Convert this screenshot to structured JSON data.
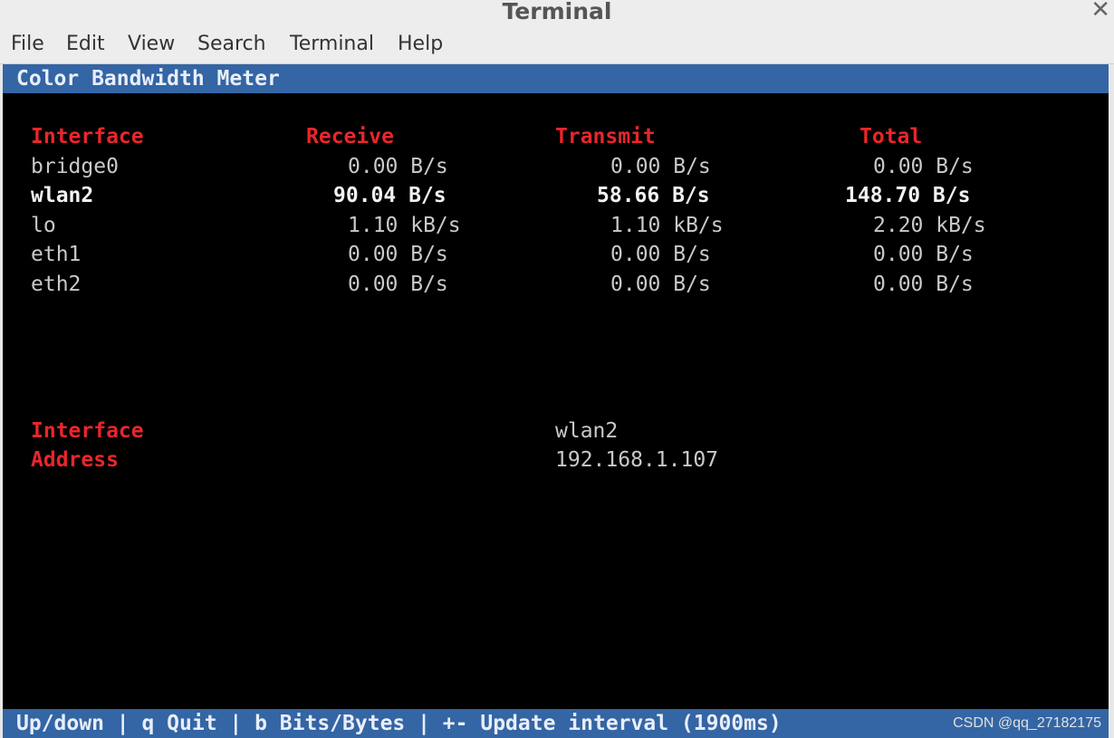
{
  "window": {
    "title": "Terminal"
  },
  "menu": [
    "File",
    "Edit",
    "View",
    "Search",
    "Terminal",
    "Help"
  ],
  "app": {
    "header": "Color Bandwidth Meter",
    "table": {
      "columns": [
        "Interface",
        "Receive",
        "Transmit",
        "Total"
      ],
      "rows": [
        {
          "iface": "bridge0",
          "receive": "0.00 B/s",
          "transmit": "0.00 B/s",
          "total": "0.00 B/s",
          "active": false
        },
        {
          "iface": "wlan2",
          "receive": "90.04 B/s",
          "transmit": "58.66 B/s",
          "total": "148.70 B/s",
          "active": true
        },
        {
          "iface": "lo",
          "receive": "1.10 kB/s",
          "transmit": "1.10 kB/s",
          "total": "2.20 kB/s",
          "active": false
        },
        {
          "iface": "eth1",
          "receive": "0.00 B/s",
          "transmit": "0.00 B/s",
          "total": "0.00 B/s",
          "active": false
        },
        {
          "iface": "eth2",
          "receive": "0.00 B/s",
          "transmit": "0.00 B/s",
          "total": "0.00 B/s",
          "active": false
        }
      ]
    },
    "details": {
      "interface_label": "Interface",
      "interface_value": "wlan2",
      "address_label": "Address",
      "address_value": "192.168.1.107"
    },
    "footer": "Up/down | q Quit | b Bits/Bytes | +- Update interval (1900ms)"
  },
  "watermark": "CSDN @qq_27182175",
  "colors": {
    "header_red": "#e8262b",
    "bar_blue": "#3465a4",
    "terminal_bg": "#000000",
    "text_gray": "#c9c9c9"
  }
}
